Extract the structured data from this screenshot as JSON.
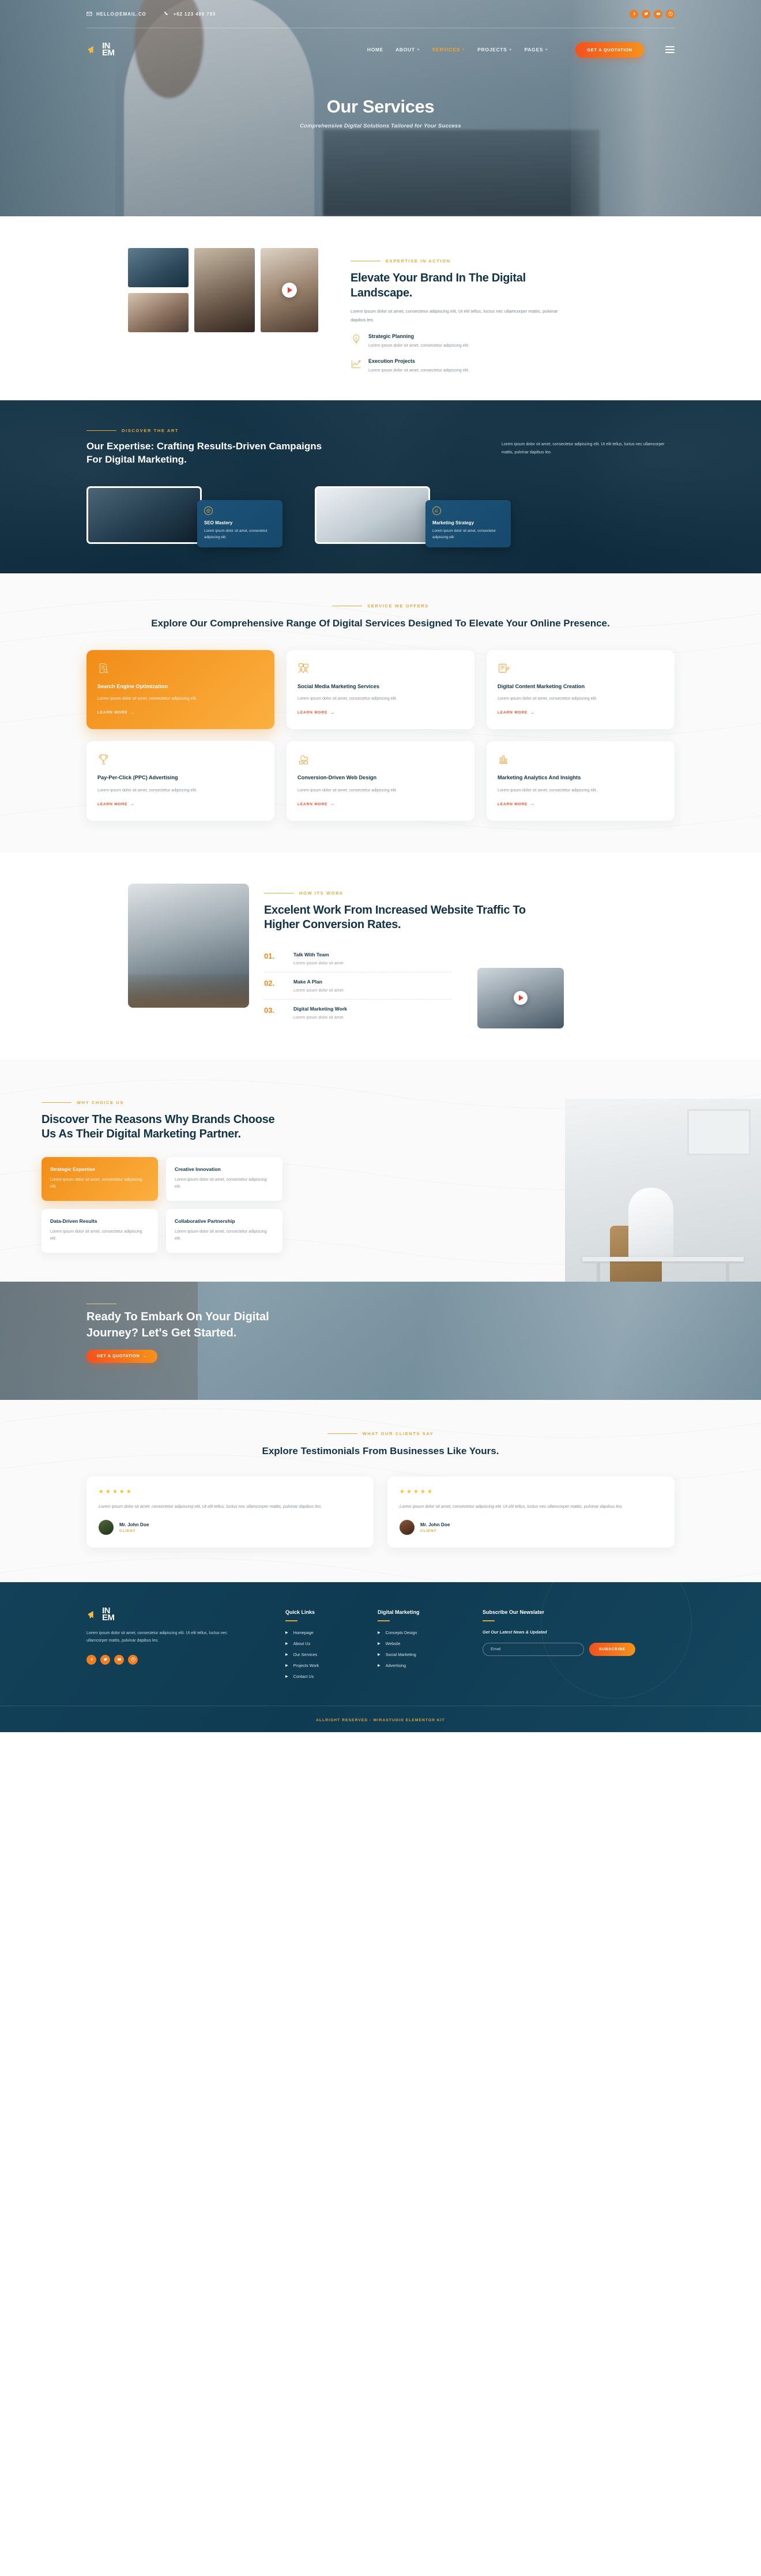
{
  "topbar": {
    "email": "HELLO@EMAIL.CO",
    "phone": "+62 123 486 789",
    "socials": [
      "facebook-icon",
      "twitter-icon",
      "youtube-icon",
      "pinterest-icon"
    ]
  },
  "nav": {
    "logo": {
      "line1": "IN",
      "line2": "EM"
    },
    "items": [
      {
        "label": "HOME",
        "has_dropdown": false,
        "active": false
      },
      {
        "label": "ABOUT",
        "has_dropdown": true,
        "active": false
      },
      {
        "label": "SERVICES",
        "has_dropdown": true,
        "active": true
      },
      {
        "label": "PROJECTS",
        "has_dropdown": true,
        "active": false
      },
      {
        "label": "PAGES",
        "has_dropdown": true,
        "active": false
      }
    ],
    "quote_button": "GET A QUOTATION"
  },
  "hero": {
    "title": "Our Services",
    "subtitle": "Comprehensive Digital Solutions Tailored for Your Success"
  },
  "about": {
    "kicker": "EXPERTISE IN ACTION",
    "heading": "Elevate Your Brand In The Digital Landscape.",
    "paragraph": "Lorem ipsum dolor sit amet, consectetur adipiscing elit. Ut elit tellus, luctus nec ullamcorper mattis, pulvinar dapibus leo.",
    "features": [
      {
        "icon": "lightbulb-idea-icon",
        "title": "Strategic Planning",
        "text": "Lorem ipsum dolor sit amet, consectetur adipiscing elit."
      },
      {
        "icon": "growth-chart-icon",
        "title": "Execution Projects",
        "text": "Lorem ipsum dolor sit amet, consectetur adipiscing elit."
      }
    ]
  },
  "expertise": {
    "kicker": "DISCOVER THE ART",
    "heading": "Our Expertise: Crafting Results-Driven Campaigns For Digital Marketing.",
    "paragraph": "Lorem ipsum dolor sit amet, consectetur adipiscing elit. Ut elit tellus, luctus nec ullamcorper mattis, pulvinar dapibus leo.",
    "cards": [
      {
        "icon": "globe-seo-icon",
        "title": "SEO Mastery",
        "text": "Lorem ipsum dolor sit amet, consectetur adipiscing elit."
      },
      {
        "icon": "megaphone-strategy-icon",
        "title": "Marketing Strategy",
        "text": "Lorem ipsum dolor sit amet, consectetur adipiscing elit."
      }
    ]
  },
  "services": {
    "kicker": "SERVICE WE OFFERS",
    "heading": "Explore Our Comprehensive Range Of Digital Services Designed To Elevate Your Online Presence.",
    "learn_more": "LEARN MORE",
    "items": [
      {
        "icon": "seo-document-search-icon",
        "title": "Search Engine Optimization",
        "text": "Lorem ipsum dolor sit amet, consectetur adipiscing elit.",
        "highlight": true
      },
      {
        "icon": "social-media-people-icon",
        "title": "Social Media Marketing Services",
        "text": "Lorem ipsum dolor sit amet, consectetur adipiscing elit.",
        "highlight": false
      },
      {
        "icon": "content-creation-icon",
        "title": "Digital Content Marketing Creation",
        "text": "Lorem ipsum dolor sit amet, consectetur adipiscing elit.",
        "highlight": false
      },
      {
        "icon": "trophy-icon",
        "title": "Pay-Per-Click (PPC) Advertising",
        "text": "Lorem ipsum dolor sit amet, consectetur adipiscing elit.",
        "highlight": false
      },
      {
        "icon": "cloud-web-design-icon",
        "title": "Conversion-Driven Web Design",
        "text": "Lorem ipsum dolor sit amet, consectetur adipiscing elit.",
        "highlight": false
      },
      {
        "icon": "bar-chart-analytics-icon",
        "title": "Marketing Analytics And Insights",
        "text": "Lorem ipsum dolor sit amet, consectetur adipiscing elit.",
        "highlight": false
      }
    ]
  },
  "how_it_works": {
    "kicker": "HOW ITS WORK",
    "heading": "Excelent Work From Increased Website Traffic To Higher Conversion Rates.",
    "steps": [
      {
        "number": "01.",
        "title": "Talk With Team",
        "text": "Lorem ipsum dolor sit amet"
      },
      {
        "number": "02.",
        "title": "Make A Plan",
        "text": "Lorem ipsum dolor sit amet"
      },
      {
        "number": "03.",
        "title": "Digital Marketing Work",
        "text": "Lorem ipsum dolor sit amet"
      }
    ]
  },
  "why_choose": {
    "kicker": "WHY CHOICE US",
    "heading": "Discover The Reasons Why Brands Choose Us As Their Digital Marketing Partner.",
    "cards": [
      {
        "title": "Strategic Expertise",
        "text": "Lorem ipsum dolor sit amet, consectetur adipiscing elit.",
        "highlight": true
      },
      {
        "title": "Creative Innovation",
        "text": "Lorem ipsum dolor sit amet, consectetur adipiscing elit.",
        "highlight": false
      },
      {
        "title": "Data-Driven Results",
        "text": "Lorem ipsum dolor sit amet, consectetur adipiscing elit.",
        "highlight": false
      },
      {
        "title": "Collaborative Partnership",
        "text": "Lorem ipsum dolor sit amet, consectetur adipiscing elit.",
        "highlight": false
      }
    ]
  },
  "cta": {
    "heading": "Ready To Embark On Your Digital Journey? Let's Get Started.",
    "button": "GET A QUOTATION"
  },
  "testimonials": {
    "kicker": "WHAT OUR CLIENTS SAY",
    "heading": "Explore Testimonials From Businesses Like Yours.",
    "items": [
      {
        "stars": 5,
        "quote": "Lorem ipsum dolor sit amet, consectetur adipiscing elit. Ut elit tellus, luctus nec ullamcorper mattis, pulvinar dapibus leo.",
        "name": "Mr. John Doe",
        "role": "CLIENT"
      },
      {
        "stars": 5,
        "quote": "Lorem ipsum dolor sit amet, consectetur adipiscing elit. Ut elit tellus, luctus nec ullamcorper mattis, pulvinar dapibus leo.",
        "name": "Mr. John Doe",
        "role": "CLIENT"
      }
    ]
  },
  "footer": {
    "logo": {
      "line1": "IN",
      "line2": "EM"
    },
    "about": "Lorem ipsum dolor sit amet, consectetur adipiscing elit. Ut elit tellus, luctus nec ullamcorper mattis, pulvinar dapibus leo.",
    "socials": [
      "facebook-icon",
      "twitter-icon",
      "youtube-icon",
      "pinterest-icon"
    ],
    "quick_links": {
      "title": "Quick Links",
      "items": [
        "Homepage",
        "About Us",
        "Our Services",
        "Projects Work",
        "Contact Us"
      ]
    },
    "digital_marketing": {
      "title": "Digital Marketing",
      "items": [
        "Concepts Design",
        "Website",
        "Social Marketing",
        "Advertising"
      ]
    },
    "newsletter": {
      "title": "Subscribe Our Newslater",
      "tagline": "Get Our Latest News & Updated",
      "placeholder": "Email",
      "input_value": "",
      "button": "SUBSCRIBE"
    },
    "copyright": "ALLRIGHT RESERVED - WIRASTUDIO ELEMENTOR KIT"
  },
  "colors": {
    "orange": "#F2871C",
    "orange_gradient_start": "#F4511E",
    "gold": "#D9A63E",
    "navy": "#123246",
    "footer_bg": "#0f3b52",
    "red_link": "#EB4B2A"
  }
}
